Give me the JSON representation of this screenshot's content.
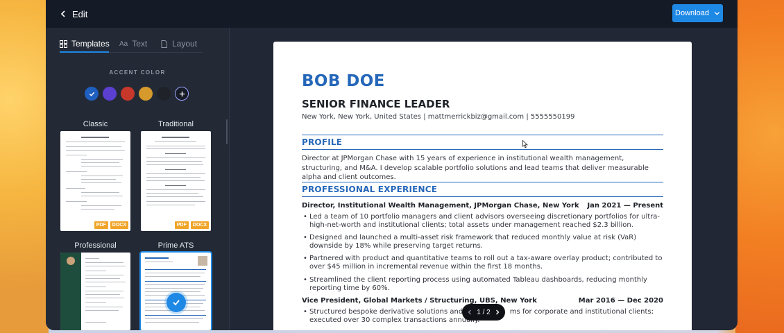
{
  "header": {
    "back_label": "Edit",
    "download_label": "Download"
  },
  "sidebar": {
    "tabs": [
      {
        "label": "Templates",
        "active": true,
        "icon": "grid-icon"
      },
      {
        "label": "Text",
        "active": false,
        "icon": "font-icon"
      },
      {
        "label": "Layout",
        "active": false,
        "icon": "document-icon"
      }
    ],
    "accent_label": "ACCENT COLOR",
    "accent_colors": [
      "#1f5fbf",
      "#5b3fd0",
      "#c8382a",
      "#d69a2c",
      "#1f2329"
    ],
    "selected_accent": "#1f5fbf",
    "templates": [
      {
        "name": "Classic",
        "formats": [
          "PDF",
          "DOCX"
        ]
      },
      {
        "name": "Traditional",
        "formats": [
          "PDF",
          "DOCX"
        ]
      },
      {
        "name": "Professional",
        "formats": []
      },
      {
        "name": "Prime ATS",
        "formats": [],
        "selected": true
      }
    ]
  },
  "resume": {
    "name": "BOB DOE",
    "title": "SENIOR FINANCE LEADER",
    "contact": "New York, New York, United States | mattmerrickbiz@gmail.com | 5555550199",
    "sections": {
      "profile_heading": "PROFILE",
      "profile_text": "Director at JPMorgan Chase with 15 years of experience in institutional wealth management, structuring, and M&A. I develop scalable portfolio solutions and lead teams that deliver measurable alpha and client outcomes.",
      "experience_heading": "PROFESSIONAL EXPERIENCE"
    },
    "jobs": [
      {
        "title": "Director, Institutional Wealth Management, JPMorgan Chase, New York",
        "dates": "Jan 2021 — Present",
        "bullets": [
          "Led a team of 10 portfolio managers and client advisors overseeing discretionary portfolios for ultra-high-net-worth and institutional clients; total assets under management reached $2.3 billion.",
          "Designed and launched a multi-asset risk framework that reduced monthly value at risk (VaR) downside by 18% while preserving target returns.",
          "Partnered with product and quantitative teams to roll out a tax-aware overlay product; contributed to over $45 million in incremental revenue within the first 18 months.",
          "Streamlined the client reporting process using automated Tableau dashboards, reducing monthly reporting time by 60%."
        ]
      },
      {
        "title": "Vice President, Global Markets / Structuring, UBS, New York",
        "dates": "Mar 2016 — Dec 2020",
        "bullets": [
          "Structured bespoke derivative solutions and h",
          "ms for corporate and institutional clients;",
          "executed over 30 complex transactions annually."
        ]
      }
    ]
  },
  "pager": {
    "label": "1 / 2"
  }
}
